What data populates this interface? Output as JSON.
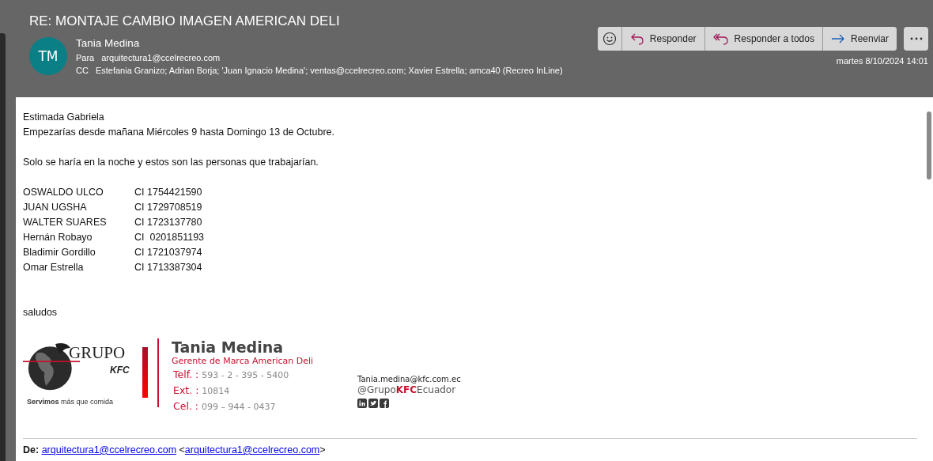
{
  "message": {
    "subject": "RE: MONTAJE CAMBIO IMAGEN AMERICAN DELI",
    "sender": {
      "initials": "TM",
      "name": "Tania Medina"
    },
    "to_label": "Para",
    "to": "arquitectura1@ccelrecreo.com",
    "cc_label": "CC",
    "cc": "Estefania Granizo; Adrian Borja; 'Juan Ignacio Medina'; ventas@ccelrecreo.com; Xavier Estrella; amca40 (Recreo InLine)",
    "date": "martes 8/10/2024 14:01",
    "actions": [
      {
        "kind": "react"
      },
      {
        "kind": "reply",
        "label": "Responder"
      },
      {
        "kind": "reply_all",
        "label": "Responder a todos"
      },
      {
        "kind": "forward",
        "label": "Reenviar"
      }
    ],
    "more": {
      "kind": "more"
    }
  },
  "body": {
    "greeting": "Estimada Gabriela",
    "intro": "Empezarías desde mañana Miércoles 9 hasta Domingo 13 de Octubre.",
    "note": "Solo se haría en la noche y estos son las personas que trabajarían.",
    "people": [
      {
        "name": "OSWALDO ULCO",
        "id": "CI 1754421590"
      },
      {
        "name": "JUAN UGSHA",
        "id": "CI 1729708519"
      },
      {
        "name": "WALTER SUARES",
        "id": "CI 1723137780"
      },
      {
        "name": "Hernán Robayo",
        "id": "CI  0201851193"
      },
      {
        "name": "Bladimir Gordillo",
        "id": "CI 1721037974"
      },
      {
        "name": "Omar Estrella",
        "id": "CI 1713387304"
      }
    ],
    "closing": "saludos"
  },
  "signature": {
    "logo_word": "GRUPO",
    "logo_brand": "KFC",
    "tagline": "**Servimos** más que comida",
    "name": "Tania Medina",
    "role": "Gerente de Marca American Deli",
    "phones": [
      {
        "label": "Telf. :",
        "value": "593 - 2 - 395 - 5400"
      },
      {
        "label": "Ext. :",
        "value": "10814"
      },
      {
        "label": "Cel. :",
        "value": "099 – 944 - 0437"
      }
    ],
    "email": "Tania.medina@kfc.com.ec",
    "handle": "@Grupo**KFC**Ecuador",
    "socials": [
      {
        "kind": "linkedin"
      },
      {
        "kind": "twitter"
      },
      {
        "kind": "facebook"
      }
    ]
  },
  "quoted": {
    "label": "De:",
    "link": "arquitectura1@ccelrecreo.com",
    "bracket_open": "<",
    "address": "arquitectura1@ccelrecreo.com",
    "bracket_close": ">"
  }
}
